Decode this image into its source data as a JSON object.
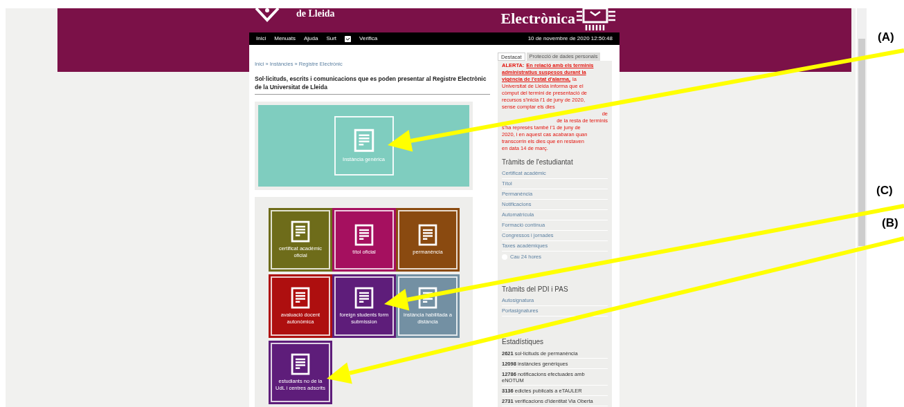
{
  "header": {
    "institution_line": "de Lleida",
    "title": "Electrònica"
  },
  "nav": {
    "items": [
      "Inici",
      "Menuats",
      "Ajuda",
      "Surt"
    ],
    "verify": "Verifica",
    "datetime": "10 de novembre de 2020 12:50:48"
  },
  "breadcrumb": "Inici » Instàncies » Registre Electrònic",
  "heading": "Sol·licituds, escrits i comunicacions que es poden presentar al Registre Electrònic de la Universitat de Lleida",
  "featured_tile": {
    "label": "Instància genèrica",
    "color": "#7fcdbf"
  },
  "tiles": [
    {
      "label": "certificat acadèmic oficial",
      "color": "#6e6c1a"
    },
    {
      "label": "títol oficial",
      "color": "#a5105f"
    },
    {
      "label": "permanència",
      "color": "#8a4a10"
    },
    {
      "label": "avaluació docent autonòmica",
      "color": "#ae0f0f"
    },
    {
      "label": "foreign students form submission",
      "color": "#5e1d7a"
    },
    {
      "label": "instància habilitada a distància",
      "color": "#7390a3"
    },
    {
      "label": "estudiants no de la UdL i centres adscrits",
      "color": "#5e1d7a"
    }
  ],
  "sidebar": {
    "tabs": [
      {
        "label": "Destacat",
        "selected": true
      },
      {
        "label": "Protecció de dades personals",
        "selected": false
      }
    ],
    "alert": [
      {
        "kind": "line",
        "parts": [
          {
            "kind": "prefix",
            "text": "ALERTA:"
          },
          {
            "kind": "link",
            "text": "En relació amb els terminis"
          }
        ]
      },
      {
        "kind": "line",
        "parts": [
          {
            "kind": "link",
            "text": "administratius suspesos durant la"
          }
        ]
      },
      {
        "kind": "line",
        "parts": [
          {
            "kind": "link",
            "text": "vigència de l'estat d'alarma,"
          },
          {
            "kind": "text",
            "text": "la"
          }
        ]
      },
      {
        "kind": "line",
        "parts": [
          {
            "kind": "text",
            "text": "Universitat de Lleida informa que el"
          }
        ]
      },
      {
        "kind": "line",
        "parts": [
          {
            "kind": "text",
            "text": "còmput del termini de presentació de"
          }
        ]
      },
      {
        "kind": "line",
        "parts": [
          {
            "kind": "text",
            "text": "recursos s'inicia l'1 de juny de 2020,"
          }
        ]
      },
      {
        "kind": "line",
        "parts": [
          {
            "kind": "text",
            "text": "sense comptar els dies"
          }
        ]
      },
      {
        "kind": "line-end",
        "parts": [
          {
            "kind": "text",
            "text": "de"
          }
        ]
      },
      {
        "kind": "line-end",
        "parts": [
          {
            "kind": "text",
            "text": "de la resta de terminis"
          }
        ]
      },
      {
        "kind": "line",
        "parts": [
          {
            "kind": "text",
            "text": "s'ha represès també l'1 de juny de"
          }
        ]
      },
      {
        "kind": "line",
        "parts": [
          {
            "kind": "text",
            "text": "2020, i en aquest cas acabaran quan"
          }
        ]
      },
      {
        "kind": "line",
        "parts": [
          {
            "kind": "text",
            "text": "transcorrin els dies que en restaven"
          }
        ]
      },
      {
        "kind": "line",
        "parts": [
          {
            "kind": "text",
            "text": "en data 14 de març."
          }
        ]
      }
    ],
    "sections": [
      {
        "title": "Tràmits de l'estudiantat",
        "links": [
          "Certificat acadèmic",
          "Títol",
          "Permanència",
          "Notificacions",
          "Automatrícula",
          "Formació contínua",
          "Congressos i jornades",
          "Taxes acadèmiques"
        ],
        "extra": "Cau 24 hores"
      },
      {
        "title": "Tràmits del PDI i PAS",
        "links": [
          "Autosignatura",
          "Portasignatures"
        ]
      },
      {
        "title": "Estadístiques",
        "stats": [
          "**2621** sol·licituds de permanència",
          "**12098** instàncies genèriques",
          "**12786** notificacions efectuades amb eNOTUM",
          "**3136** edictes publicats a eTAULER",
          "**2731** verificacions d'identitat Via Oberta"
        ]
      }
    ]
  },
  "annotations": [
    {
      "label": "(A)"
    },
    {
      "label": "(C)"
    },
    {
      "label": "(B)"
    }
  ]
}
